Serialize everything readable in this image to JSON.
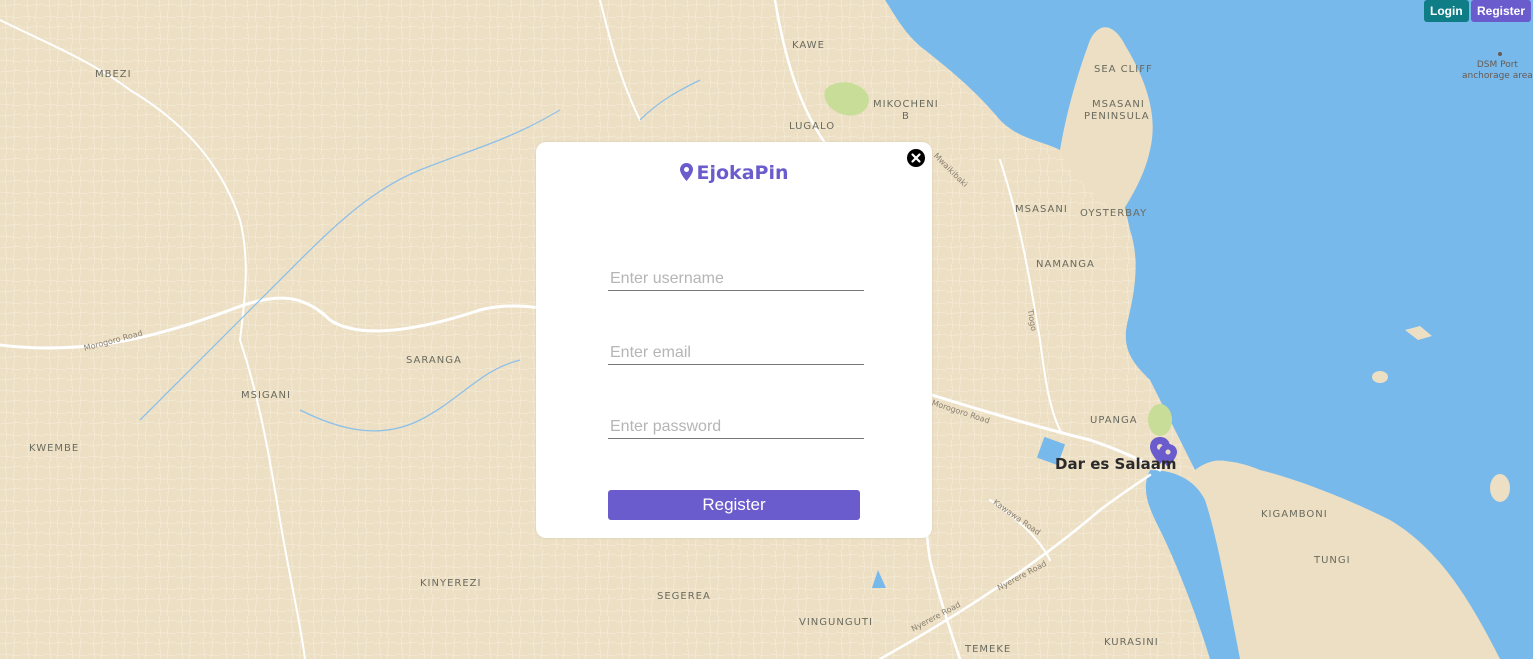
{
  "header": {
    "login_label": "Login",
    "register_label": "Register"
  },
  "modal": {
    "app_name": "EjokaPin",
    "logo_icon": "map-pin-icon",
    "close_icon": "close-icon",
    "username_placeholder": "Enter username",
    "email_placeholder": "Enter email",
    "password_placeholder": "Enter password",
    "submit_label": "Register"
  },
  "map": {
    "city": "Dar es Salaam",
    "port_label_1": "DSM Port",
    "port_label_2": "anchorage area",
    "places": [
      "MBEZI",
      "KAWE",
      "SEA CLIFF",
      "MSASANI",
      "PENINSULA",
      "MIKOCHENI",
      "B",
      "LUGALO",
      "MSASANI",
      "OYSTERBAY",
      "NAMANGA",
      "SARANGA",
      "MSIGANI",
      "KWEMBE",
      "UPANGA",
      "KIGAMBONI",
      "TUNGI",
      "KINYEREZI",
      "SEGEREA",
      "VINGUNGUTI",
      "KURASINI",
      "TEMEKE"
    ],
    "roads": [
      "Morogoro Road",
      "Morogoro Road",
      "Kawawa Road",
      "Nyerere Road",
      "Nyerere Road",
      "Mwaikibaki",
      "Tiogo"
    ],
    "marker_color": "#6b5ccd"
  },
  "colors": {
    "land": "#ecdfc4",
    "water": "#77b9eb",
    "accent": "#6b5ccd",
    "teal": "#0f7d86"
  }
}
